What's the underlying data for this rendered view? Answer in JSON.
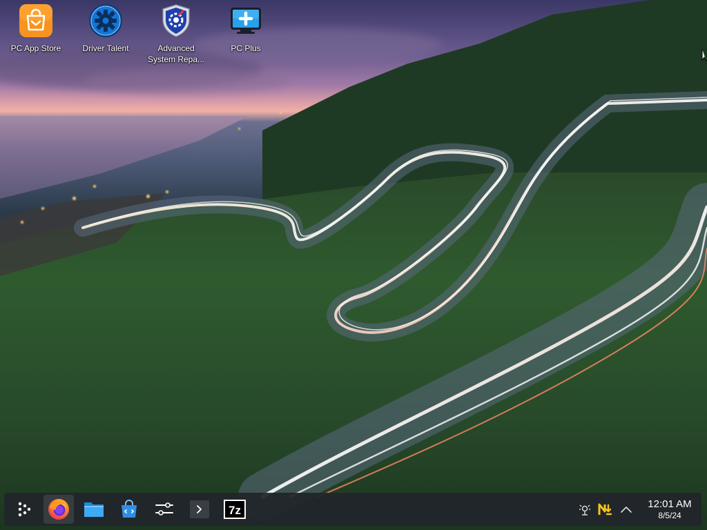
{
  "desktop": {
    "icons": [
      {
        "label": "PC App Store",
        "icon": "shopping-bag-icon"
      },
      {
        "label": "Driver Talent",
        "icon": "gear-icon"
      },
      {
        "label": "Advanced\nSystem Repa...",
        "label_line1": "Advanced",
        "label_line2": "System Repa...",
        "icon": "shield-gear-icon"
      },
      {
        "label": "PC Plus",
        "icon": "monitor-plus-icon"
      }
    ]
  },
  "taskbar": {
    "launchers": [
      {
        "name": "app-launcher",
        "icon": "app-launcher-icon"
      },
      {
        "name": "firefox",
        "icon": "firefox-icon"
      },
      {
        "name": "file-manager",
        "icon": "folder-icon"
      },
      {
        "name": "software-store",
        "icon": "store-bag-icon"
      },
      {
        "name": "settings",
        "icon": "sliders-icon"
      },
      {
        "name": "terminal",
        "icon": "terminal-icon"
      },
      {
        "name": "7zip",
        "icon": "7zip-icon",
        "text": "7z"
      }
    ],
    "tray": {
      "icons": [
        "network-icon",
        "updates-icon",
        "chevron-up-icon"
      ],
      "time": "12:01 AM",
      "date": "8/5/24"
    }
  },
  "colors": {
    "taskbar_bg": "#22252a",
    "accent_orange": "#f7931e",
    "accent_blue": "#2f8fe6"
  }
}
